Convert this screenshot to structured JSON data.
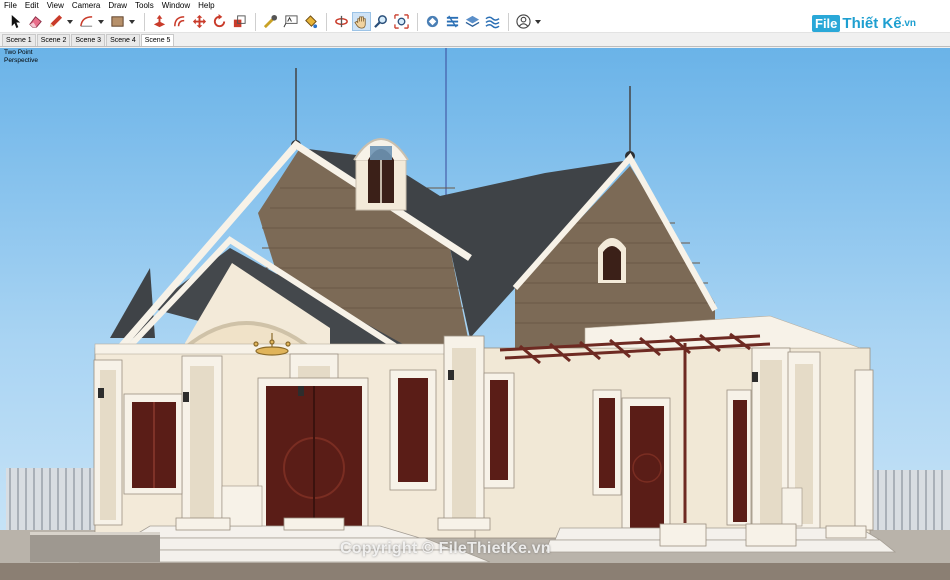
{
  "menu": {
    "items": [
      "File",
      "Edit",
      "View",
      "Camera",
      "Draw",
      "Tools",
      "Window",
      "Help"
    ]
  },
  "toolbar": {
    "tools": [
      {
        "name": "select-tool",
        "icon": "arrow-cursor-icon"
      },
      {
        "name": "eraser-tool",
        "icon": "eraser-icon"
      },
      {
        "name": "line-tool",
        "icon": "pencil-icon",
        "dropdown": true
      },
      {
        "name": "arc-tool",
        "icon": "arc-icon",
        "dropdown": true
      },
      {
        "name": "shape-tool",
        "icon": "rectangle-icon",
        "dropdown": true
      },
      {
        "name": "push-pull-tool",
        "icon": "push-pull-icon"
      },
      {
        "name": "offset-tool",
        "icon": "offset-icon"
      },
      {
        "name": "move-tool",
        "icon": "move-icon"
      },
      {
        "name": "rotate-tool",
        "icon": "rotate-icon"
      },
      {
        "name": "scale-tool",
        "icon": "scale-icon"
      },
      {
        "name": "tape-measure-tool",
        "icon": "tape-measure-icon"
      },
      {
        "name": "text-tool",
        "icon": "text-icon"
      },
      {
        "name": "paint-bucket-tool",
        "icon": "paint-bucket-icon"
      },
      {
        "name": "orbit-tool",
        "icon": "orbit-icon"
      },
      {
        "name": "pan-tool",
        "icon": "pan-hand-icon",
        "active": true
      },
      {
        "name": "zoom-tool",
        "icon": "zoom-icon"
      },
      {
        "name": "zoom-extents-tool",
        "icon": "zoom-extents-icon"
      },
      {
        "name": "warehouse-tool",
        "icon": "warehouse-icon"
      },
      {
        "name": "extension-tool",
        "icon": "extension-icon"
      },
      {
        "name": "layers-tool",
        "icon": "layers-icon"
      },
      {
        "name": "sandbox-tool",
        "icon": "sandbox-icon"
      },
      {
        "name": "account-tool",
        "icon": "user-icon",
        "dropdown": true
      }
    ]
  },
  "brand": {
    "box": "File",
    "text": "Thiết Kế",
    "suffix": ".vn"
  },
  "scenes": [
    {
      "label": "Scene 1",
      "active": false
    },
    {
      "label": "Scene 2",
      "active": false
    },
    {
      "label": "Scene 3",
      "active": false
    },
    {
      "label": "Scene 4",
      "active": false
    },
    {
      "label": "Scene 5",
      "active": true
    }
  ],
  "viewport": {
    "camera_line1": "Two Point",
    "camera_line2": "Perspective",
    "watermark": "Copyright © FileThietKe.vn"
  },
  "colors": {
    "sky_top": "#6ab3e8",
    "wall": "#f3ead9",
    "trim": "#f7f2e8",
    "roof": "#3f4347",
    "gable_siding": "#7c6a56",
    "wood": "#5a1d17",
    "pergola": "#6e2a22"
  }
}
